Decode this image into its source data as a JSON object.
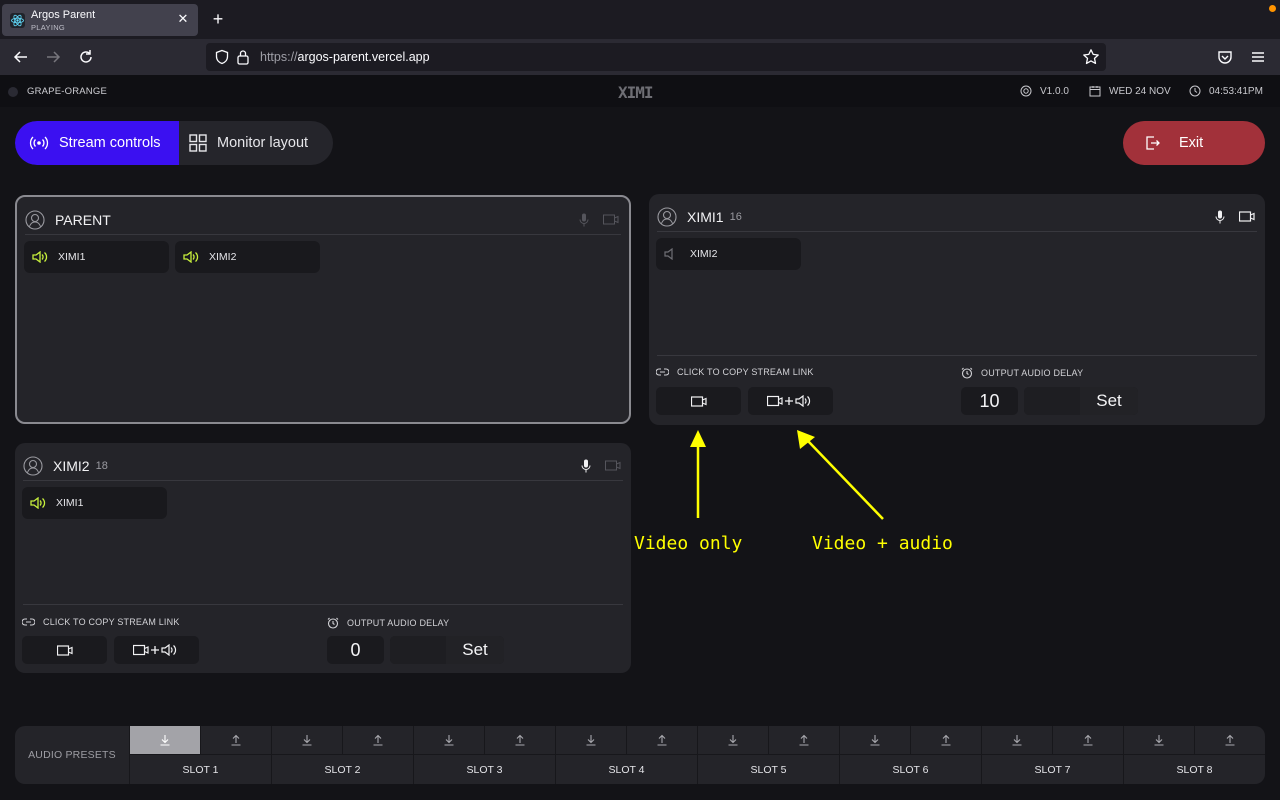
{
  "browser": {
    "tab_title": "Argos Parent",
    "tab_subtitle": "PLAYING",
    "url_protocol": "https://",
    "url_host": "argos-parent.vercel.app"
  },
  "header": {
    "room_name": "GRAPE-ORANGE",
    "logo": "XIMI",
    "version": "V1.0.0",
    "date": "WED 24 NOV",
    "time": "04:53:41PM"
  },
  "mode_toggle": {
    "stream_controls_label": "Stream controls",
    "monitor_layout_label": "Monitor layout",
    "active": "stream_controls"
  },
  "exit_label": "Exit",
  "colors": {
    "accent": "#3b10f1",
    "exit": "#a2313a",
    "speaker_active": "#c8f03c",
    "annotation": "#ffff00"
  },
  "panels": {
    "parent": {
      "name": "PARENT",
      "count": "",
      "mic_enabled": false,
      "camera_enabled": false,
      "sources": [
        {
          "label": "XIMI1",
          "audio_active": true
        },
        {
          "label": "XIMI2",
          "audio_active": true
        }
      ]
    },
    "ximi1": {
      "name": "XIMI1",
      "count": "16",
      "mic_enabled": true,
      "camera_enabled": true,
      "sources": [
        {
          "label": "XIMI2",
          "audio_active": false
        }
      ],
      "stream_link_label": "CLICK TO COPY STREAM LINK",
      "delay_label": "OUTPUT AUDIO DELAY",
      "delay_value": "10",
      "delay_input": "",
      "set_label": "Set"
    },
    "ximi2": {
      "name": "XIMI2",
      "count": "18",
      "mic_enabled": true,
      "camera_enabled": false,
      "sources": [
        {
          "label": "XIMI1",
          "audio_active": true
        }
      ],
      "stream_link_label": "CLICK TO COPY STREAM LINK",
      "delay_label": "OUTPUT AUDIO DELAY",
      "delay_value": "0",
      "delay_input": "",
      "set_label": "Set"
    }
  },
  "annotations": {
    "video_only": "Video only",
    "video_audio": "Video + audio"
  },
  "presets": {
    "label": "AUDIO PRESETS",
    "slots": [
      {
        "name": "SLOT 1",
        "load_active": true
      },
      {
        "name": "SLOT 2",
        "load_active": false
      },
      {
        "name": "SLOT 3",
        "load_active": false
      },
      {
        "name": "SLOT 4",
        "load_active": false
      },
      {
        "name": "SLOT 5",
        "load_active": false
      },
      {
        "name": "SLOT 6",
        "load_active": false
      },
      {
        "name": "SLOT 7",
        "load_active": false
      },
      {
        "name": "SLOT 8",
        "load_active": false
      }
    ]
  }
}
